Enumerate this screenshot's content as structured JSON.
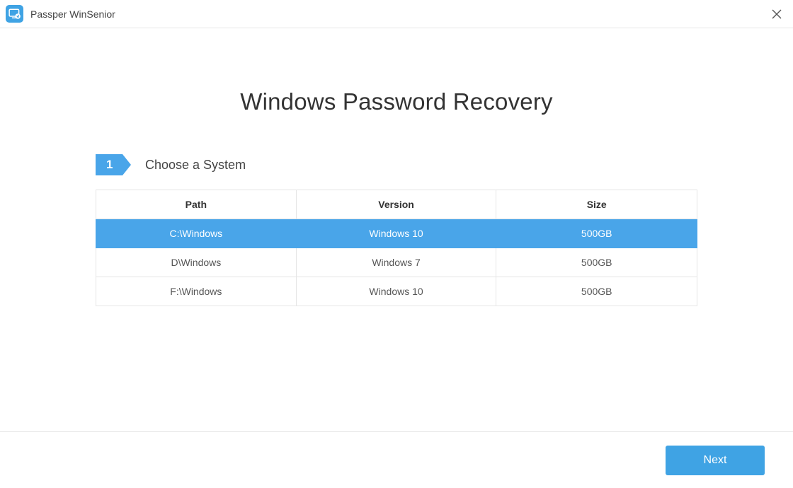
{
  "app": {
    "title": "Passper WinSenior"
  },
  "page": {
    "title": "Windows Password Recovery"
  },
  "step": {
    "number": "1",
    "label": "Choose a System"
  },
  "table": {
    "headers": {
      "path": "Path",
      "version": "Version",
      "size": "Size"
    },
    "rows": [
      {
        "path": "C:\\Windows",
        "version": "Windows 10",
        "size": "500GB",
        "selected": true
      },
      {
        "path": "D\\Windows",
        "version": "Windows 7",
        "size": "500GB",
        "selected": false
      },
      {
        "path": "F:\\Windows",
        "version": "Windows 10",
        "size": "500GB",
        "selected": false
      }
    ]
  },
  "footer": {
    "next_label": "Next"
  }
}
